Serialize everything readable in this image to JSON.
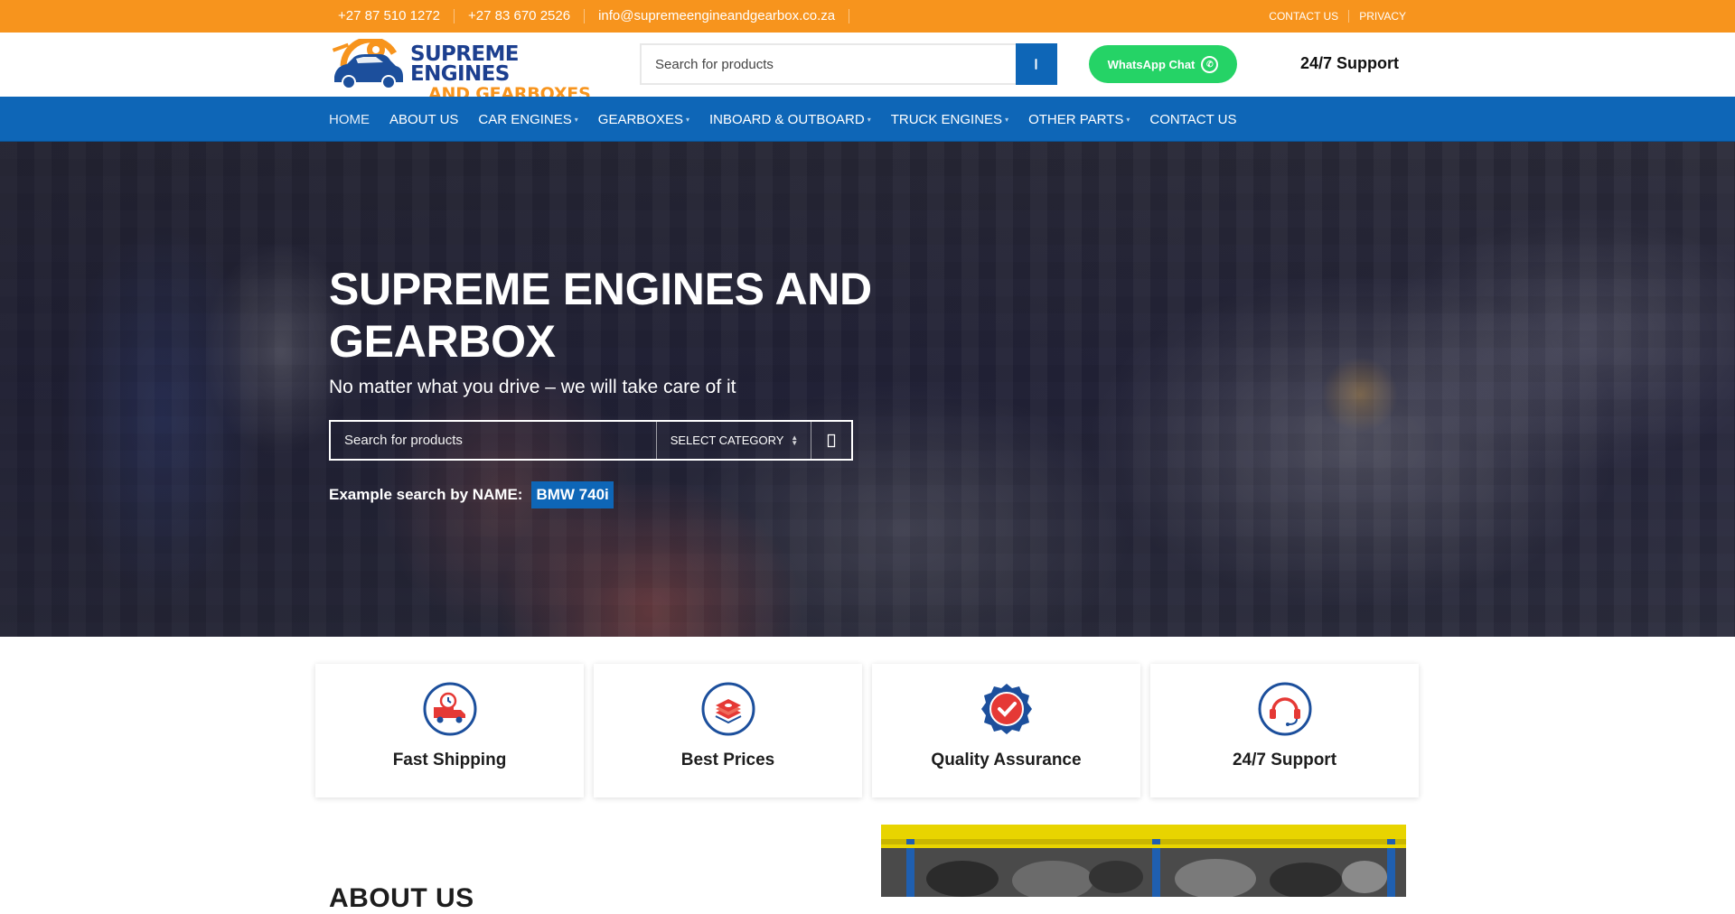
{
  "topbar": {
    "phone1": "+27 87 510 1272",
    "phone2": "+27 83 670 2526",
    "email": "info@supremeengineandgearbox.co.za",
    "links": [
      "CONTACT US",
      "PRIVACY"
    ]
  },
  "header": {
    "logo_line1": "SUPREME ENGINES",
    "logo_line2": "AND GEARBOXES",
    "search_placeholder": "Search for products",
    "whatsapp_label": "WhatsApp Chat",
    "support_label": "24/7 Support"
  },
  "nav": {
    "items": [
      {
        "label": "HOME",
        "active": true
      },
      {
        "label": "ABOUT US"
      },
      {
        "label": "CAR ENGINES",
        "dropdown": true
      },
      {
        "label": "GEARBOXES",
        "dropdown": true
      },
      {
        "label": "INBOARD & OUTBOARD",
        "dropdown": true
      },
      {
        "label": "TRUCK ENGINES",
        "dropdown": true
      },
      {
        "label": "OTHER PARTS",
        "dropdown": true
      },
      {
        "label": "CONTACT US"
      }
    ]
  },
  "hero": {
    "title": "SUPREME ENGINES AND GEARBOX",
    "tagline": "No matter what you drive – we will take care of it",
    "search_placeholder": "Search for products",
    "category_label": "SELECT CATEGORY",
    "example_label": "Example search by NAME:",
    "example_value": "BMW 740i"
  },
  "features": [
    {
      "label": "Fast Shipping",
      "icon": "truck-clock-icon"
    },
    {
      "label": "Best Prices",
      "icon": "money-stack-icon"
    },
    {
      "label": "Quality Assurance",
      "icon": "badge-check-icon"
    },
    {
      "label": "24/7 Support",
      "icon": "headset-icon"
    }
  ],
  "about": {
    "title": "ABOUT US"
  },
  "colors": {
    "topbar": "#f7941d",
    "brand_blue": "#0e66b7",
    "whatsapp": "#25d366",
    "icon_red": "#e53935",
    "icon_navy": "#1c4f9c"
  }
}
